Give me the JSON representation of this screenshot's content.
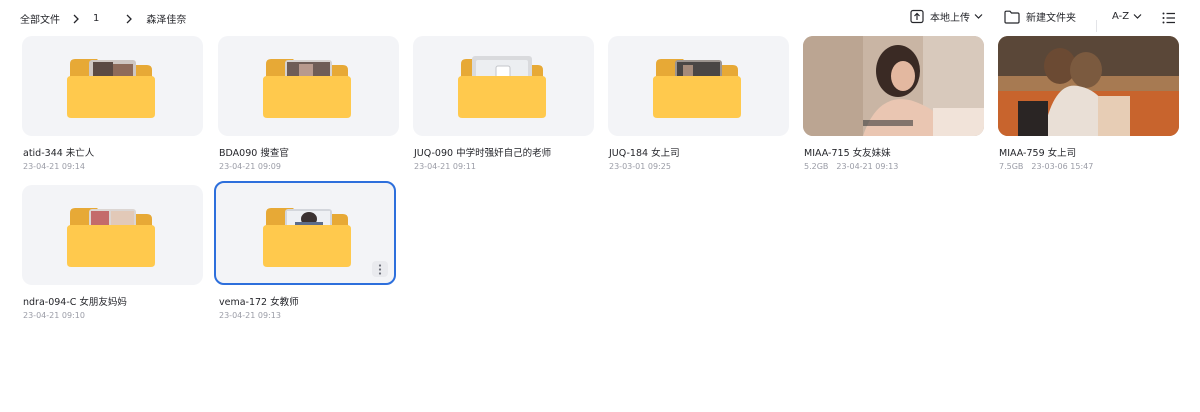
{
  "breadcrumb": {
    "items": [
      "全部文件",
      "1",
      "森泽佳奈"
    ]
  },
  "toolbar": {
    "upload_label": "本地上传",
    "new_folder_label": "新建文件夹",
    "sort_label": "A-Z"
  },
  "files": [
    {
      "name": "atid-344 未亡人",
      "date": "23-04-21 09:14",
      "type": "folder"
    },
    {
      "name": "BDA090 搜查官",
      "date": "23-04-21 09:09",
      "type": "folder"
    },
    {
      "name": "JUQ-090 中学时强奸自己的老师",
      "date": "23-04-21 09:11",
      "type": "folder"
    },
    {
      "name": "JUQ-184 女上司",
      "date": "23-03-01 09:25",
      "type": "folder"
    },
    {
      "name": "MIAA-715 女友妹妹",
      "size": "5.2GB",
      "date": "23-04-21 09:13",
      "type": "video"
    },
    {
      "name": "MIAA-759 女上司",
      "size": "7.5GB",
      "date": "23-03-06 15:47",
      "type": "video"
    },
    {
      "name": "ndra-094-C 女朋友妈妈",
      "date": "23-04-21 09:10",
      "type": "folder"
    },
    {
      "name": "vema-172 女教师",
      "date": "23-04-21 09:13",
      "type": "folder",
      "selected": true
    }
  ],
  "colors": {
    "folder_back": "#e7a936",
    "folder_front": "#ffc94d",
    "selection": "#2d6fdc",
    "card_bg": "#f3f4f7"
  }
}
